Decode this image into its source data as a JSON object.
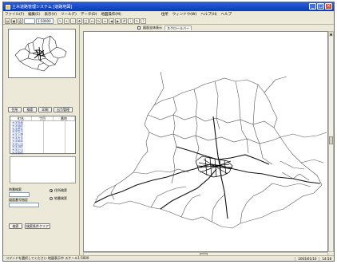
{
  "window": {
    "title": "土木道路管理システム [道路地図]",
    "controls": [
      "_",
      "□",
      "×"
    ]
  },
  "menu": [
    "ファイル(F)",
    "編集(E)",
    "表示(V)",
    "ツール(T)",
    "データ(D)",
    "地図操作(M)",
    "住所",
    "ウィンドウ(W)",
    "ヘルプ(H)",
    "ヘルプ"
  ],
  "toolbar": {
    "search_value": "",
    "zoom_value": "1:50000"
  },
  "subbar": {
    "checkbox_label": "図面全体表示",
    "tab_label": "スクロールバー"
  },
  "left_panel": {
    "tabs": [
      "住所",
      "検索",
      "印刷",
      "出力管理"
    ],
    "list_headers": [
      "町名",
      "丁目",
      "番地"
    ],
    "list_items": [
      "大字赤坂",
      "大字旭町",
      "大字荒井",
      "大字石川",
      "大字上野",
      "大字大手",
      "大字岡本",
      "大字川口",
      "大字北町",
      "大字小山",
      "大字栄町",
      "大字新町",
      "大字中央"
    ],
    "field1_label": "地番検索",
    "field2_label": "図面番号指定",
    "radio_on_label": "住所検索",
    "radio_off_label": "地番検索",
    "search_button": "検索",
    "clear_button": "検索条件クリア"
  },
  "status": {
    "message": "コマンドを選択してください 地図表示中 スケール1:5000",
    "date": "2003/01/10",
    "time": "14:58"
  }
}
